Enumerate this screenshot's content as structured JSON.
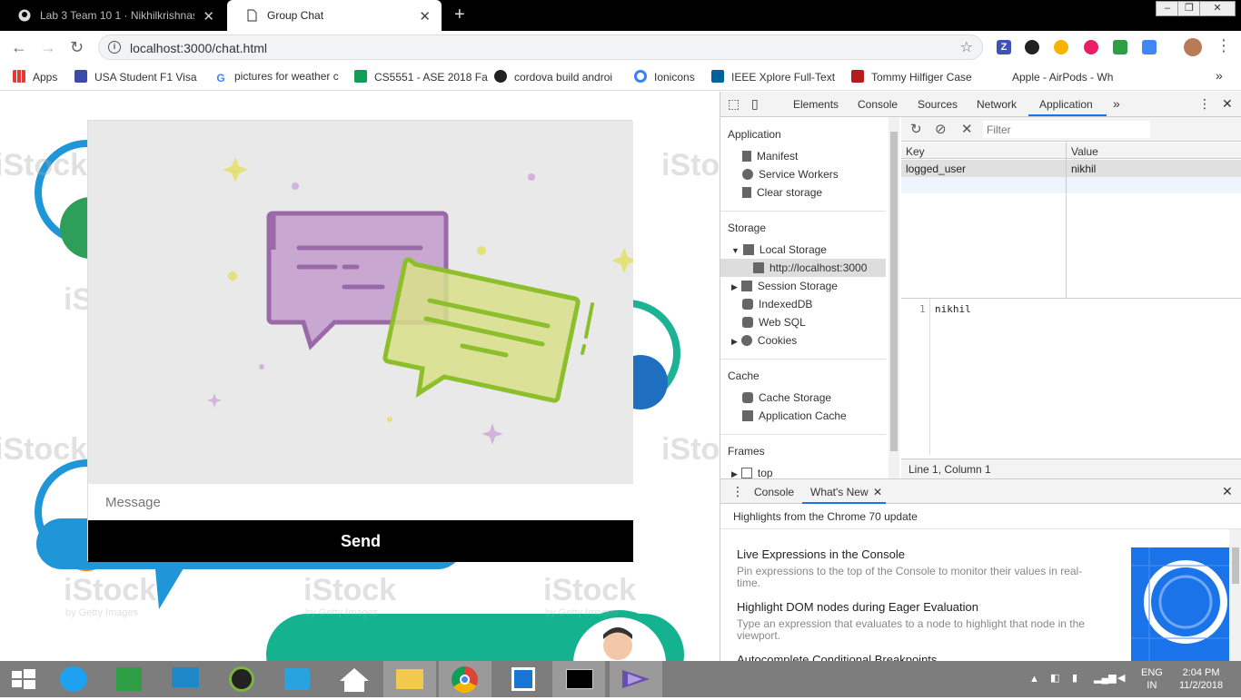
{
  "browser": {
    "tabs": [
      {
        "title": "Lab 3 Team 10 1 · Nikhilkrishnas/",
        "active": false,
        "icon": "github-icon"
      },
      {
        "title": "Group Chat",
        "active": true,
        "icon": "page-icon"
      }
    ],
    "url": "localhost:3000/chat.html",
    "bookmarks": [
      {
        "label": "Apps",
        "icon": "apps-grid-icon"
      },
      {
        "label": "USA Student F1 Visa",
        "icon": "plane-icon"
      },
      {
        "label": "pictures for weather c",
        "icon": "google-icon"
      },
      {
        "label": "CS5551 - ASE 2018 Fa",
        "icon": "sheets-icon"
      },
      {
        "label": "cordova build androi",
        "icon": "github-icon"
      },
      {
        "label": "Ionicons",
        "icon": "ionicons-icon"
      },
      {
        "label": "IEEE Xplore Full-Text",
        "icon": "ieee-icon"
      },
      {
        "label": "Tommy Hilfiger Case",
        "icon": "tommy-icon"
      },
      {
        "label": "Apple - AirPods - Wh",
        "icon": "apple-icon"
      }
    ]
  },
  "page": {
    "message_placeholder": "Message",
    "send_label": "Send",
    "watermark": "iStock",
    "watermark_sub": "by Getty Images"
  },
  "devtools": {
    "tabs": [
      "Elements",
      "Console",
      "Sources",
      "Network",
      "Application"
    ],
    "active_tab": "Application",
    "more": "»",
    "sidebar": {
      "application_header": "Application",
      "application_items": [
        "Manifest",
        "Service Workers",
        "Clear storage"
      ],
      "storage_header": "Storage",
      "storage_items": [
        "Local Storage",
        "http://localhost:3000",
        "Session Storage",
        "IndexedDB",
        "Web SQL",
        "Cookies"
      ],
      "cache_header": "Cache",
      "cache_items": [
        "Cache Storage",
        "Application Cache"
      ],
      "frames_header": "Frames",
      "frames_items": [
        "top"
      ]
    },
    "filter_placeholder": "Filter",
    "table": {
      "columns": [
        "Key",
        "Value"
      ],
      "rows": [
        {
          "key": "logged_user",
          "value": "nikhil"
        }
      ]
    },
    "preview": {
      "line_number": "1",
      "text": "nikhil"
    },
    "status": "Line 1, Column 1",
    "drawer": {
      "tabs": [
        "Console",
        "What's New"
      ],
      "active": "What's New",
      "highlights": "Highlights from the Chrome 70 update",
      "items": [
        {
          "title": "Live Expressions in the Console",
          "desc": "Pin expressions to the top of the Console to monitor their values in real-time."
        },
        {
          "title": "Highlight DOM nodes during Eager Evaluation",
          "desc": "Type an expression that evaluates to a node to highlight that node in the viewport."
        },
        {
          "title": "Autocomplete Conditional Breakpoints",
          "desc": ""
        }
      ]
    }
  },
  "taskbar": {
    "lang": "ENG",
    "region": "IN",
    "time": "2:04 PM",
    "date": "11/2/2018"
  },
  "colors": {
    "accent": "#1a73e8",
    "chat_bubble_purple": "#c8a7d1",
    "chat_bubble_green": "#d8e08a",
    "green_stroke": "#8cbf2b",
    "purple_stroke": "#9a6aa8"
  }
}
